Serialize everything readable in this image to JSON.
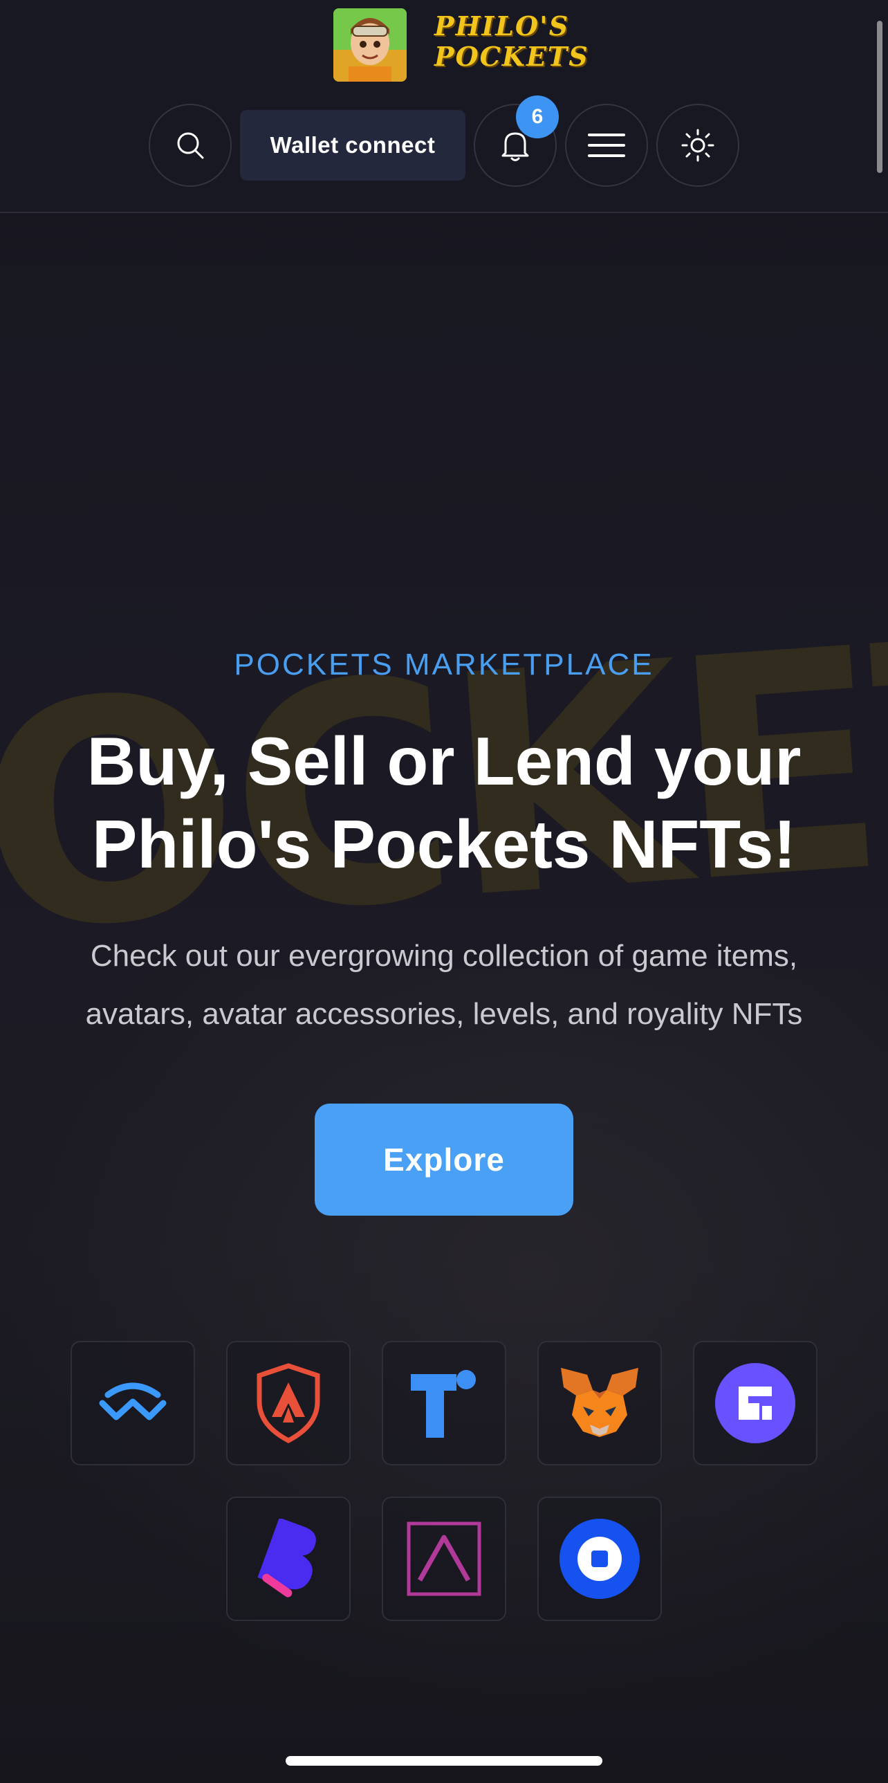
{
  "header": {
    "logo_text_line1": "PHILO'S",
    "logo_text_line2": "POCKETS",
    "wallet_connect_label": "Wallet connect",
    "notification_count": "6"
  },
  "hero": {
    "watermark": "OCKETS",
    "eyebrow": "POCKETS MARKETPLACE",
    "headline_line1": "Buy, Sell or Lend your",
    "headline_line2": "Philo's Pockets NFTs!",
    "sub_line1": "Check out our evergrowing collection of game items,",
    "sub_line2": "avatars, avatar accessories, levels, and royality NFTs",
    "explore_label": "Explore"
  },
  "wallets": [
    {
      "icon": "walletconnect-icon",
      "color": "#3b99fc"
    },
    {
      "icon": "avalanche-shield-icon",
      "color": "#e8503a"
    },
    {
      "icon": "trust-t-icon",
      "color": "#3b8ff5"
    },
    {
      "icon": "metamask-fox-icon",
      "color": "#e2761b"
    },
    {
      "icon": "fortmatic-icon",
      "color": "#6851ff"
    },
    {
      "icon": "bitski-b-icon",
      "color": "#4a2cf0"
    },
    {
      "icon": "arkane-a-icon",
      "color": "#b0399a"
    },
    {
      "icon": "coinbase-icon",
      "color": "#1652f0"
    }
  ],
  "colors": {
    "accent": "#4aa0f4",
    "background": "#181822",
    "badge": "#3d94f2"
  }
}
